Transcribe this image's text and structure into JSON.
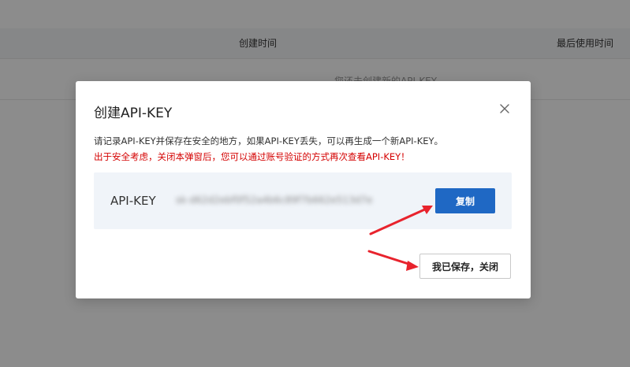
{
  "background": {
    "columns": {
      "created": "创建时间",
      "last_used": "最后使用时间"
    },
    "empty_text": "您还未创建新的API-KEY"
  },
  "modal": {
    "title": "创建API-KEY",
    "info_text": "请记录API-KEY并保存在安全的地方，如果API-KEY丢失，可以再生成一个新API-KEY。",
    "warning_text": "出于安全考虑，关闭本弹窗后，您可以通过账号验证的方式再次查看API-KEY！",
    "key_label": "API-KEY",
    "key_value": "sk-d62d2ebf0f52a4b6c89f7b662e513d7e",
    "copy_label": "复制",
    "saved_close_label": "我已保存，关闭"
  },
  "colors": {
    "primary": "#1f68c4",
    "warning": "#d40000",
    "annotation_arrow": "#e8232d"
  },
  "icons": {
    "close": "close-icon"
  }
}
